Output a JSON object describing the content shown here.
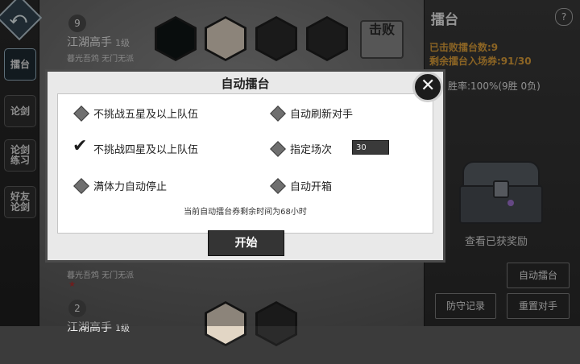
{
  "left_nav": {
    "items": [
      {
        "label": "擂台",
        "active": true
      },
      {
        "label": "论剑",
        "active": false
      },
      {
        "label": "论剑\n练习",
        "active": false
      },
      {
        "label": "好友\n论剑",
        "active": false
      }
    ]
  },
  "players": [
    {
      "rank": "9",
      "name": "江湖高手",
      "level": "1级",
      "subtitle": "暮光吾鸩 无门无派",
      "result": "击败"
    },
    {
      "rank": "",
      "name": "",
      "level": "",
      "subtitle": "暮光吾鸩 无门无派"
    },
    {
      "rank": "2",
      "name": "江湖高手",
      "level": "1级",
      "subtitle": ""
    }
  ],
  "right_panel": {
    "title": "擂台",
    "help_icon": "?",
    "defeated_label": "已击败擂台数:9",
    "remaining_tickets_label": "剩余擂台入场券:91/30",
    "win_rate": "胜率:100%(9胜 0负)",
    "rewards_label": "查看已获奖励",
    "auto_arena_button": "自动擂台",
    "defense_record_button": "防守记录",
    "reset_opponents_button": "重置对手"
  },
  "dialog": {
    "title": "自动擂台",
    "options": [
      {
        "label": "不挑战五星及以上队伍",
        "checked": false
      },
      {
        "label": "自动刷新对手",
        "checked": false
      },
      {
        "label": "不挑战四星及以上队伍",
        "checked": true
      },
      {
        "label": "指定场次",
        "checked": false
      },
      {
        "label": "满体力自动停止",
        "checked": false
      },
      {
        "label": "自动开箱",
        "checked": false
      }
    ],
    "venue_value": "30",
    "remaining_time_text": "当前自动擂台券剩余时间为68小时",
    "start_button": "开始",
    "close_icon": "close-icon"
  }
}
